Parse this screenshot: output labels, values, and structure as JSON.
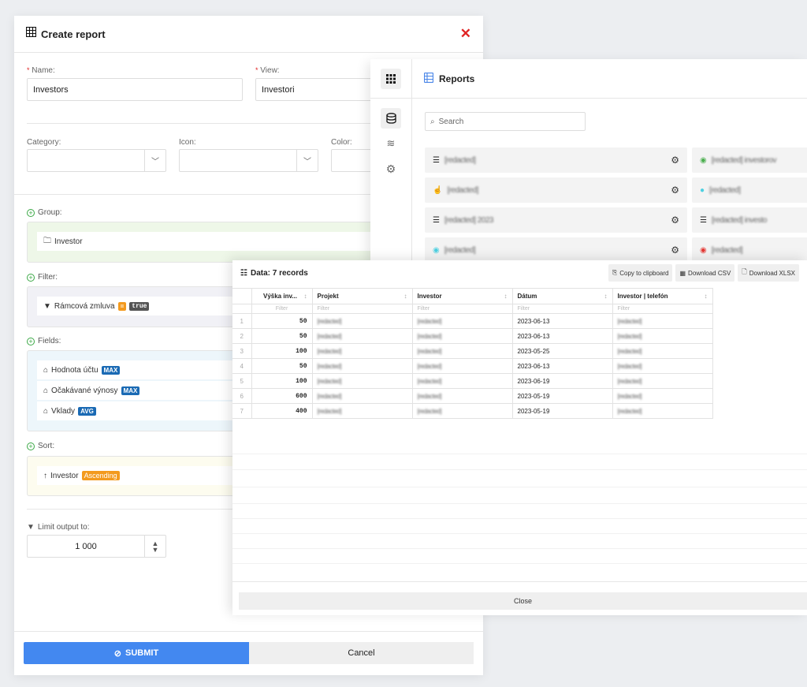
{
  "create_report": {
    "title": "Create report",
    "close_icon": "close-x-icon",
    "name_label": "Name:",
    "name_value": "Investors",
    "view_label": "View:",
    "view_value": "Investori",
    "required_mark": "*",
    "category_label": "Category:",
    "icon_label": "Icon:",
    "color_label": "Color:",
    "group": {
      "label": "Group:",
      "items": [
        {
          "text": "Investor",
          "icon": "folder-icon"
        }
      ]
    },
    "filter": {
      "label": "Filter:",
      "items": [
        {
          "text": "Rámcová zmluva",
          "operator": "=",
          "value": "true"
        }
      ]
    },
    "fields": {
      "label": "Fields:",
      "items": [
        {
          "text": "Hodnota účtu",
          "agg": "MAX"
        },
        {
          "text": "Očakávané výnosy",
          "agg": "MAX"
        },
        {
          "text": "Vklady",
          "agg": "AVG"
        }
      ]
    },
    "sort": {
      "label": "Sort:",
      "items": [
        {
          "text": "Investor",
          "direction": "Ascending"
        }
      ]
    },
    "limit_label": "Limit output to:",
    "limit_value": "1 000",
    "submit_label": "SUBMIT",
    "cancel_label": "Cancel"
  },
  "reports": {
    "title": "Reports",
    "search_placeholder": "Search",
    "items": [
      {
        "name": "[redacted]",
        "icon": "list-icon"
      },
      {
        "name": "[redacted] investorov",
        "icon": "user-circle-icon-green"
      },
      {
        "name": "[redacted]",
        "icon": "hand-icon"
      },
      {
        "name": "[redacted]",
        "icon": "coin-icon-cyan"
      },
      {
        "name": "[redacted] 2023",
        "icon": "list-icon"
      },
      {
        "name": "[redacted] investo",
        "icon": "list-icon"
      },
      {
        "name": "[redacted]",
        "icon": "user-circle-icon-cyan"
      },
      {
        "name": "[redacted]",
        "icon": "user-circle-icon-red"
      }
    ]
  },
  "data_panel": {
    "title": "Data: 7 records",
    "copy_label": "Copy to clipboard",
    "csv_label": "Download CSV",
    "xlsx_label": "Download XLSX",
    "filter_placeholder": "Filter",
    "columns": [
      "Výška inv...",
      "Projekt",
      "Investor",
      "Dátum",
      "Investor | telefón"
    ],
    "rows": [
      {
        "n": "1",
        "amount": "50",
        "project": "[redacted]",
        "investor": "[redacted]",
        "date": "2023-06-13",
        "phone": "[redacted]"
      },
      {
        "n": "2",
        "amount": "50",
        "project": "[redacted]",
        "investor": "[redacted]",
        "date": "2023-06-13",
        "phone": "[redacted]"
      },
      {
        "n": "3",
        "amount": "100",
        "project": "[redacted]",
        "investor": "[redacted]",
        "date": "2023-05-25",
        "phone": "[redacted]"
      },
      {
        "n": "4",
        "amount": "50",
        "project": "[redacted]",
        "investor": "[redacted]",
        "date": "2023-06-13",
        "phone": "[redacted]"
      },
      {
        "n": "5",
        "amount": "100",
        "project": "[redacted]",
        "investor": "[redacted]",
        "date": "2023-06-19",
        "phone": "[redacted]"
      },
      {
        "n": "6",
        "amount": "600",
        "project": "[redacted]",
        "investor": "[redacted]",
        "date": "2023-05-19",
        "phone": "[redacted]"
      },
      {
        "n": "7",
        "amount": "400",
        "project": "[redacted]",
        "investor": "[redacted]",
        "date": "2023-05-19",
        "phone": "[redacted]"
      }
    ],
    "close_label": "Close"
  },
  "colors": {
    "primary": "#4388f0",
    "danger": "#e02424",
    "agg_badge": "#1a6ab4",
    "sort_badge": "#f39a1e",
    "group_bg": "#eef7e8",
    "filter_bg": "#f1f1f6",
    "fields_bg": "#edf6fb",
    "sort_bg": "#fdfcef"
  }
}
